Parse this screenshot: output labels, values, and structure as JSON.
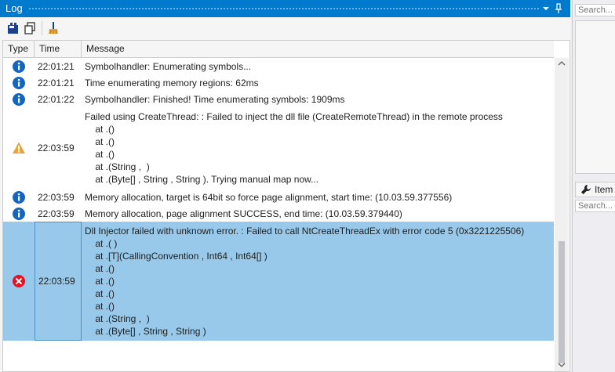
{
  "log": {
    "title": "Log",
    "pin_glyph": "↕",
    "columns": {
      "type": "Type",
      "time": "Time",
      "message": "Message"
    },
    "rows": [
      {
        "level": "info",
        "icon": "info-icon",
        "time": "22:01:21",
        "message": "Symbolhandler: Enumerating symbols..."
      },
      {
        "level": "info",
        "icon": "info-icon",
        "time": "22:01:21",
        "message": "Time enumerating memory regions: 62ms"
      },
      {
        "level": "info",
        "icon": "info-icon",
        "time": "22:01:22",
        "message": "Symbolhandler: Finished! Time enumerating symbols: 1909ms"
      },
      {
        "level": "warning",
        "icon": "warning-icon",
        "time": "22:03:59",
        "message": "Failed using CreateThread: : Failed to inject the dll file (CreateRemoteThread) in the remote process\n    at .()\n    at .()\n    at .()\n    at .(String ,  )\n    at .(Byte[] , String , String ). Trying manual map now..."
      },
      {
        "level": "info",
        "icon": "info-icon",
        "time": "22:03:59",
        "message": "Memory allocation, target is 64bit so force page alignment, start time: (10.03.59.377556)"
      },
      {
        "level": "info",
        "icon": "info-icon",
        "time": "22:03:59",
        "message": "Memory allocation, page alignment SUCCESS, end time: (10.03.59.379440)"
      },
      {
        "level": "error",
        "icon": "error-icon",
        "time": "22:03:59",
        "selected": true,
        "message": "Dll Injector failed with unknown error. : Failed to call NtCreateThreadEx with error code 5 (0x3221225506)\n    at .( )\n    at .[T](CallingConvention , Int64 , Int64[] )\n    at .()\n    at .()\n    at .()\n    at .()\n    at .(String ,  )\n    at .(Byte[] , String , String )"
      }
    ],
    "colors": {
      "accent": "#007acc",
      "selected_row": "#99c9ea",
      "info": "#1565c0",
      "warning": "#e8a33b",
      "error": "#e81123"
    }
  },
  "side": {
    "search_placeholder_top": "Search...",
    "search_placeholder_bottom": "Search...",
    "item_tab_label": "Item"
  }
}
